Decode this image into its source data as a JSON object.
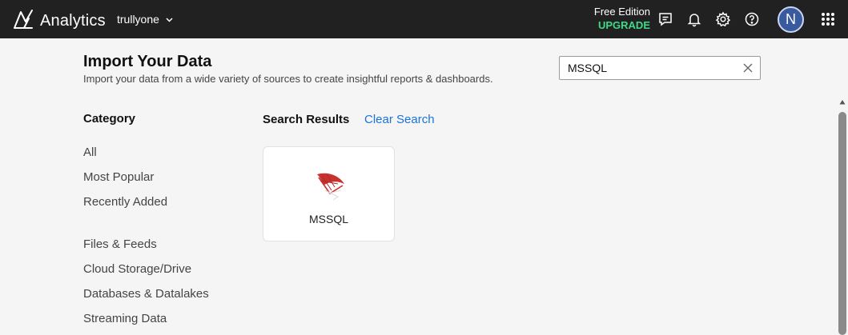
{
  "header": {
    "brand": "Analytics",
    "workspace": "trullyone",
    "edition_label": "Free Edition",
    "upgrade_label": "UPGRADE",
    "avatar_initial": "N",
    "icons": [
      "feedback-icon",
      "bell-icon",
      "gear-icon",
      "help-icon",
      "apps-grid-icon"
    ]
  },
  "page": {
    "title": "Import Your Data",
    "subtitle": "Import your data from a wide variety of sources to create insightful reports & dashboards."
  },
  "search": {
    "value": "MSSQL"
  },
  "category": {
    "heading": "Category",
    "items": [
      "All",
      "Most Popular",
      "Recently Added",
      "Files & Feeds",
      "Cloud Storage/Drive",
      "Databases & Datalakes",
      "Streaming Data"
    ]
  },
  "results": {
    "heading": "Search Results",
    "clear_label": "Clear Search",
    "cards": [
      {
        "label": "MSSQL",
        "icon": "mssql-logo-icon"
      }
    ]
  },
  "colors": {
    "topbar": "#212121",
    "upgrade": "#3fd98a",
    "link": "#1a73d9",
    "avatar": "#3a5aa0"
  }
}
